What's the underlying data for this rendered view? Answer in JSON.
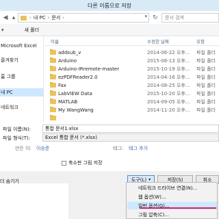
{
  "window": {
    "title": "다른 이름으로 저장"
  },
  "address": {
    "crumbs": [
      "내 PC",
      "문서"
    ],
    "search_placeholder": "문서 검색"
  },
  "toolbar": {
    "new_folder": "새 폴더"
  },
  "sidebar": {
    "items": [
      {
        "label": "Microsoft Excel",
        "selected": false
      },
      {
        "label": "즐겨찾기",
        "selected": false
      },
      {
        "label": "홈 그룹",
        "selected": false
      },
      {
        "label": "내 PC",
        "selected": true
      },
      {
        "label": "네트워크",
        "selected": false
      }
    ]
  },
  "columns": {
    "name": "이름",
    "date": "수정한 날짜",
    "type": "유형"
  },
  "files": [
    {
      "name": "addsub_v",
      "date": "2014-06-22 오후...",
      "type": "파일 폴더"
    },
    {
      "name": "Arduino",
      "date": "2015-08-13 오후...",
      "type": "파일 폴더"
    },
    {
      "name": "Arduino-IRremote-master",
      "date": "2015-10-19 오후...",
      "type": "파일 폴더"
    },
    {
      "name": "ezPDFReader2.0",
      "date": "2014-04-16 오후...",
      "type": "파일 폴더"
    },
    {
      "name": "Fax",
      "date": "2014-08-25 오후...",
      "type": "파일 폴더"
    },
    {
      "name": "LabVIEW Data",
      "date": "2015-10-20 오후...",
      "type": "파일 폴더"
    },
    {
      "name": "MATLAB",
      "date": "2014-09-05 오후...",
      "type": "파일 폴더"
    },
    {
      "name": "My WangWang",
      "date": "2014-11-20 오후...",
      "type": "파일 폴더"
    },
    {
      "name": "",
      "date": "",
      "type": ""
    }
  ],
  "save": {
    "filename_label": "파일 이름(N):",
    "filename_value": "통합 문서1.xlsx",
    "filetype_label": "파일 형식(T):",
    "filetype_value": "Excel 통합 문서 (*.xlsx)",
    "author_label": "만든 이:",
    "author_value": "이승준",
    "tags_label": "태그:",
    "tags_value": "태그 추가",
    "thumbnail_label": "축소판 그림 저장"
  },
  "bottom": {
    "hide_folders": "더 숨기기",
    "tools_label": "도구(L)",
    "save_label": "저장(S)",
    "cancel_label": "취소"
  },
  "tools_menu": {
    "items": [
      {
        "label": "네트워크 드라이브 연결(N)...",
        "highlighted": false
      },
      {
        "label": "웹 옵션(W)...",
        "highlighted": false
      },
      {
        "label": "일반 옵션(G)...",
        "highlighted": true
      },
      {
        "label": "그림 압축(C)...",
        "highlighted": false
      }
    ]
  },
  "colors": {
    "accent": "#cde8ff",
    "folder": "#e9c25b",
    "annotation": "#d62060"
  }
}
